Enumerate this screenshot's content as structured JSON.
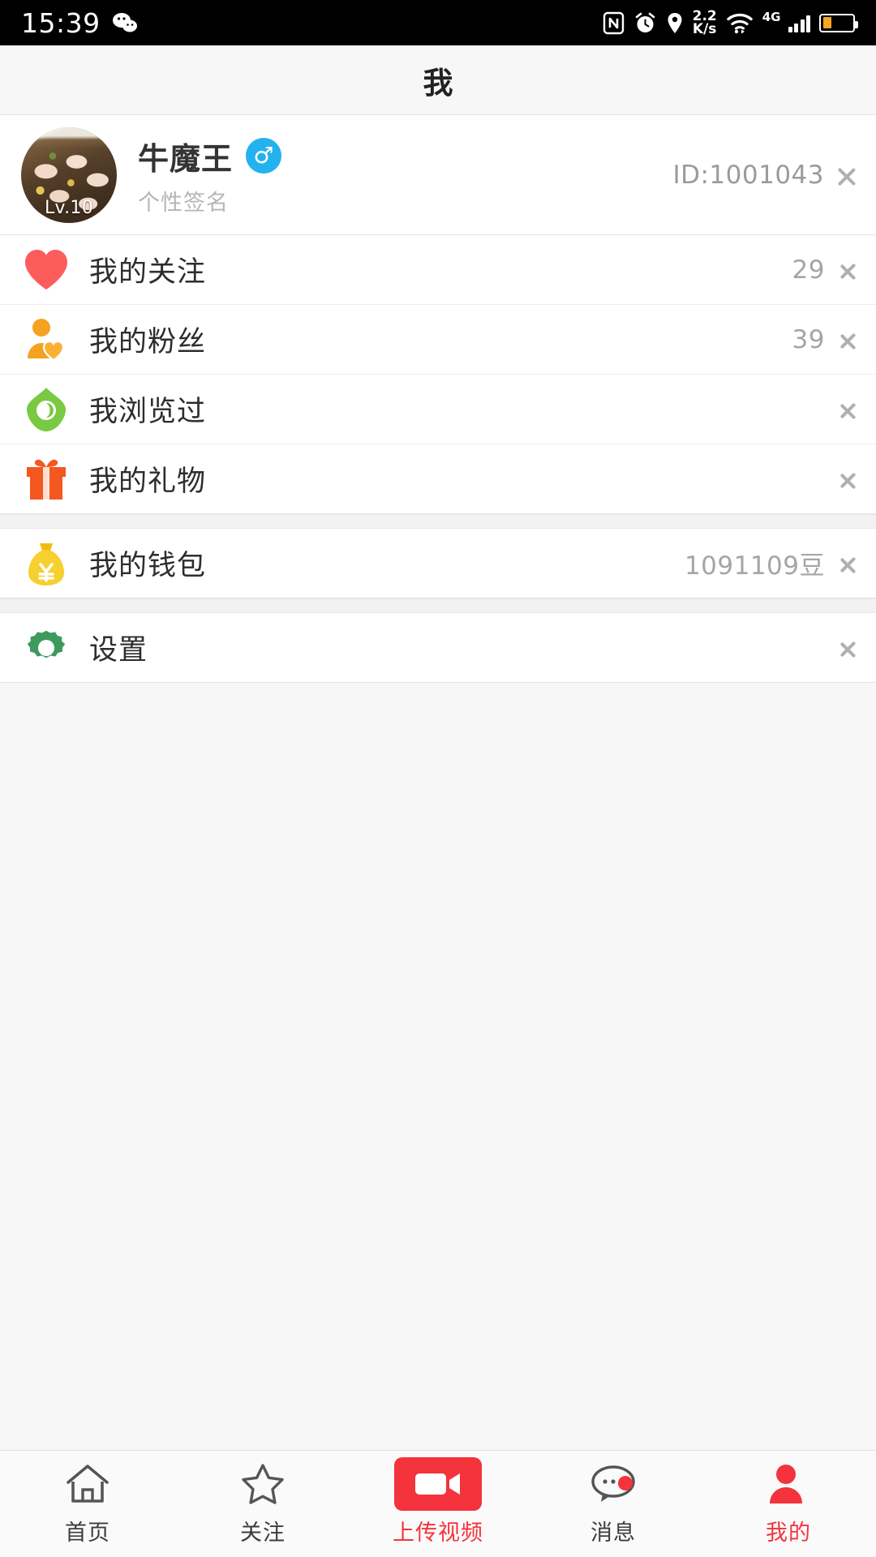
{
  "status_bar": {
    "time": "15:39",
    "wechat_icon": "wechat-icon",
    "nfc_icon": "nfc-icon",
    "alarm_icon": "alarm-icon",
    "location_icon": "location-pin-icon",
    "net_speed_value": "2.2",
    "net_speed_unit": "K/s",
    "wifi_icon": "wifi-icon",
    "network_type": "4G",
    "signal_icon": "signal-bars-icon",
    "battery_icon": "battery-icon",
    "battery_level_percent": 30
  },
  "header": {
    "title": "我"
  },
  "profile": {
    "avatar_name": "user-avatar-food-photo",
    "level_badge": "Lv.10",
    "username": "牛魔王",
    "gender_symbol": "♂",
    "gender_color": "#24b2ef",
    "signature": "个性签名",
    "id_label": "ID:1001043",
    "chevron": "chevron-right-icon"
  },
  "menu": {
    "group_one": [
      {
        "key": "following",
        "icon": "heart-icon",
        "icon_color": "#fc5c5c",
        "label": "我的关注",
        "value": "29"
      },
      {
        "key": "fans",
        "icon": "person-heart-icon",
        "icon_color": "#f5a21e",
        "label": "我的粉丝",
        "value": "39"
      },
      {
        "key": "browsed",
        "icon": "eye-icon",
        "icon_color": "#7ac943",
        "label": "我浏览过",
        "value": ""
      },
      {
        "key": "gifts",
        "icon": "gift-icon",
        "icon_color": "#f4571f",
        "label": "我的礼物",
        "value": ""
      }
    ],
    "group_two": [
      {
        "key": "wallet",
        "icon": "money-bag-icon",
        "icon_color": "#f5cb1e",
        "label": "我的钱包",
        "value": "1091109豆"
      }
    ],
    "group_three": [
      {
        "key": "settings",
        "icon": "gear-icon",
        "icon_color": "#3d9a5c",
        "label": "设置",
        "value": ""
      }
    ]
  },
  "tabbar": {
    "accent_color": "#f4333c",
    "items": [
      {
        "key": "home",
        "icon": "home-icon",
        "label": "首页",
        "active": false
      },
      {
        "key": "follow",
        "icon": "star-icon",
        "label": "关注",
        "active": false
      },
      {
        "key": "upload",
        "icon": "video-camera-icon",
        "label": "上传视频",
        "active": true
      },
      {
        "key": "message",
        "icon": "chat-bubble-icon",
        "label": "消息",
        "active": false
      },
      {
        "key": "mine",
        "icon": "person-icon",
        "label": "我的",
        "active": true
      }
    ]
  }
}
